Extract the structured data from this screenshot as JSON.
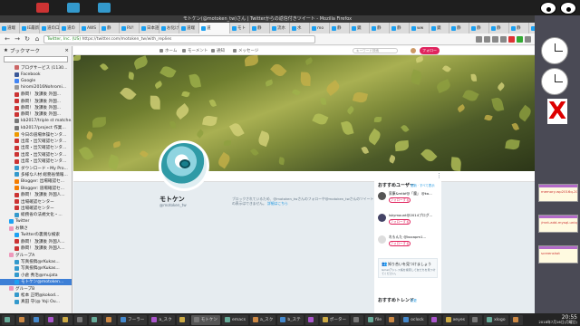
{
  "firefox": {
    "window_title": "モトケン(@motoken_tw)さん | Twitterからの返信付きツイート - Mozilla Firefox",
    "tabs": [
      "道端",
      "IE最新",
      "道の口",
      "道の",
      "AWS",
      "静",
      "RV!",
      "日本語",
      "お化け",
      "道端",
      "道",
      "モト",
      "静",
      "流水",
      "水",
      "mo",
      "静",
      "鏡",
      "静",
      "静",
      "ww",
      "鏡",
      "静",
      "静",
      "静",
      "静",
      "道",
      "関",
      "静"
    ],
    "active_tab_index": 10,
    "url_ssl": "Twitter, Inc. (US)",
    "url_path": "https://twitter.com/motoken_tw/with_replies"
  },
  "sidebar": {
    "title": "ブックマーク",
    "bookmarks": [
      {
        "label": "ブログサービス (1130...",
        "color": "#c66"
      },
      {
        "label": "Facebook",
        "color": "#3b5998"
      },
      {
        "label": "Google",
        "color": "#4285f4"
      },
      {
        "label": "hiromi2016Nohromi...",
        "color": "#999"
      },
      {
        "label": "静岡！ 放課後 外国...",
        "color": "#c33"
      },
      {
        "label": "静岡！ 放課後 外国...",
        "color": "#c33"
      },
      {
        "label": "静岡！ 放課後 外国...",
        "color": "#c33"
      },
      {
        "label": "静岡！ 放課後 外国...",
        "color": "#c33"
      },
      {
        "label": "kb2017/triple st matche...",
        "color": "#777"
      },
      {
        "label": "kb2017/project 作業...",
        "color": "#777"
      },
      {
        "label": "今日の道場体操センタ...",
        "color": "#e90"
      },
      {
        "label": "出席・出欠確認センタ...",
        "color": "#c33"
      },
      {
        "label": "出席・出欠確認センタ...",
        "color": "#c33"
      },
      {
        "label": "出席・出欠確認センタ...",
        "color": "#c33"
      },
      {
        "label": "出席・出欠確認センタ...",
        "color": "#c33"
      },
      {
        "label": "ダウンロード・My Pro...",
        "color": "#39c"
      },
      {
        "label": "多様な人材 総務省情報...",
        "color": "#39c"
      },
      {
        "label": "Blogger: 出場確認セ...",
        "color": "#f57d00"
      },
      {
        "label": "Blogger: 道場確認セ...",
        "color": "#f57d00"
      },
      {
        "label": "静岡！ 放課後 外国人...",
        "color": "#c33"
      },
      {
        "label": "出場確認センター",
        "color": "#c33"
      },
      {
        "label": "出場確認センター",
        "color": "#c33"
      },
      {
        "label": "総務省の法規文化・...",
        "color": "#39c"
      },
      {
        "label": "Twitter",
        "color": "#1da1f2"
      },
      {
        "label": "お隣さ",
        "color": "#e9b"
      },
      {
        "label": "Twitterの裏側な検索",
        "color": "#1da1f2"
      },
      {
        "label": "静岡！ 放課後 外国人...",
        "color": "#c33"
      },
      {
        "label": "静岡！ 放課後 外国人...",
        "color": "#c33"
      },
      {
        "label": "グループA",
        "color": "#e9b"
      },
      {
        "label": "写真投稿@rKukas...",
        "color": "#39c"
      },
      {
        "label": "写真投稿@rKukas...",
        "color": "#39c"
      },
      {
        "label": "小倉 秀治@mujata",
        "color": "#39c"
      },
      {
        "label": "モトケン@motoken...",
        "color": "#1da1f2"
      },
      {
        "label": "グループB",
        "color": "#e9b"
      },
      {
        "label": "松本 正明@kokod...",
        "color": "#39c"
      },
      {
        "label": "真田 守(@ Yoji Ou...",
        "color": "#39c"
      }
    ],
    "selected_index": 32
  },
  "twitter": {
    "nav": [
      "ホーム",
      "モーメント",
      "通知",
      "メッセージ"
    ],
    "search_placeholder": "キーワード検索",
    "follow_label": "フォロー",
    "profile": {
      "name": "モトケン",
      "handle": "@motoken_tw"
    },
    "protected_note": "ブロックされているため、@motoken_twさんのフォローや@motoken_twさんのツイートの表示はできません。",
    "protected_link": "詳細はこちら",
    "suggestions_title": "おすすめユーザー",
    "suggestions_links": "更新 · すべて表示",
    "suggestions": [
      {
        "name": "家康&mtbf@「魔」 @ka...",
        "btn": "フォローする",
        "color": "#555"
      },
      {
        "name": "lskymount@2014プログ...",
        "btn": "フォローする",
        "color": "#446"
      },
      {
        "name": "れもんた @kocapm1...",
        "btn": "フォローする",
        "color": "#ddd"
      }
    ],
    "find_friends_title": "知り合いを見つけましょう",
    "find_friends_text": "Gmailアドレス帳を検索して友だちを見つけてください。",
    "trends_title": "おすすめトレンド",
    "trends_links": "変更"
  },
  "right_panel": {
    "note1": "memory-wp2016q-2016lt",
    "note2": "/mnt-add-mysql-uniq-m",
    "note3": "screenshot"
  },
  "taskbar": {
    "items": [
      "",
      "",
      "",
      "",
      "",
      "",
      "",
      "",
      "フーラー",
      "a_スク",
      "",
      "モトケン",
      "emacs",
      "a_スク",
      "b_ステ",
      "",
      "ポーター",
      "",
      "file",
      "",
      "oclock",
      "",
      "xeyes",
      "",
      "xlogo",
      ""
    ],
    "active_index": 11,
    "time": "20:55",
    "date": "2018年7月16日(月曜日)"
  }
}
